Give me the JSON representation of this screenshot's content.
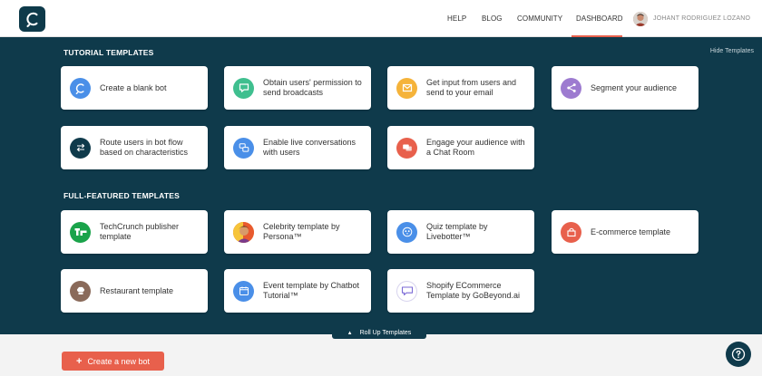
{
  "nav": {
    "help": "HELP",
    "blog": "BLOG",
    "community": "COMMUNITY",
    "dashboard": "DASHBOARD",
    "username": "JOHANT RODRIGUEZ LOZANO"
  },
  "tutorial": {
    "title": "TUTORIAL TEMPLATES",
    "hide_link": "Hide Templates",
    "cards": [
      {
        "label": "Create a blank bot",
        "icon": "chatbot-logo-icon",
        "color": "#4a8fe8"
      },
      {
        "label": "Obtain users' permission to send broadcasts",
        "icon": "message-icon",
        "color": "#3fbf8f"
      },
      {
        "label": "Get input from users and send to your email",
        "icon": "envelope-icon",
        "color": "#f5b33a"
      },
      {
        "label": "Segment your audience",
        "icon": "share-icon",
        "color": "#9d7bd0"
      },
      {
        "label": "Route users in bot flow based on characteristics",
        "icon": "route-arrows-icon",
        "color": "#0f3a4b"
      },
      {
        "label": "Enable live conversations with users",
        "icon": "live-chat-icon",
        "color": "#4a8fe8"
      },
      {
        "label": "Engage your audience with a Chat Room",
        "icon": "chat-room-icon",
        "color": "#e8604c"
      }
    ]
  },
  "featured": {
    "title": "FULL-FEATURED TEMPLATES",
    "cards": [
      {
        "label": "TechCrunch publisher template",
        "icon": "techcrunch-logo-icon",
        "color": "#1aa34a"
      },
      {
        "label": "Celebrity template by Persona™",
        "icon": "celebrity-avatar-icon",
        "color": "#f2a63a"
      },
      {
        "label": "Quiz template by Livebotter™",
        "icon": "quiz-icon",
        "color": "#4a8fe8"
      },
      {
        "label": "E-commerce template",
        "icon": "shop-icon",
        "color": "#e8604c"
      },
      {
        "label": "Restaurant template",
        "icon": "chef-hat-icon",
        "color": "#8a6a5a"
      },
      {
        "label": "Event template by Chatbot Tutorial™",
        "icon": "calendar-icon",
        "color": "#4a8fe8"
      },
      {
        "label": "Shopify ECommerce Template by GoBeyond.ai",
        "icon": "gobeyond-logo-icon",
        "color": "#ffffff"
      }
    ]
  },
  "rollup": {
    "label": "Roll Up Templates"
  },
  "create_button": {
    "label": "Create a new bot"
  }
}
